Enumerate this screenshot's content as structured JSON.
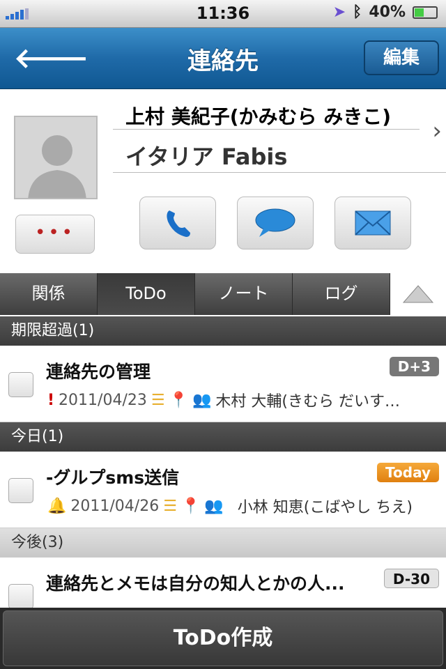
{
  "status": {
    "time": "11:36",
    "battery": "40%",
    "battery_level": 0.4
  },
  "nav": {
    "title": "連絡先",
    "edit": "編集",
    "back_icon": "arrow-left"
  },
  "contact": {
    "name": "上村 美紀子(かみむら みきこ)",
    "company": "イタリア Fabis",
    "more": "•••"
  },
  "tabs": [
    "関係",
    "ToDo",
    "ノート",
    "ログ"
  ],
  "selected_tab": "ToDo",
  "sections": {
    "overdue": "期限超過(1)",
    "today": "今日(1)",
    "future": "今後(3)"
  },
  "todos": [
    {
      "title": "連絡先の管理",
      "date": "2011/04/23",
      "person": "木村 大輔(きむら だいす…",
      "badge": "D+3",
      "badge_color": "#777777",
      "flag": "exclamation"
    },
    {
      "title": "-グルプsms送信",
      "date": "2011/04/26",
      "person": "小林 知恵(こばやし ちえ)",
      "badge": "Today",
      "badge_color": "#e8901c",
      "flag": "bell"
    },
    {
      "title": "連絡先とメモは自分の知人とかの人...",
      "badge": "D-30",
      "badge_color": "#e4e4e4"
    }
  ],
  "bottom": {
    "create": "ToDo作成"
  }
}
